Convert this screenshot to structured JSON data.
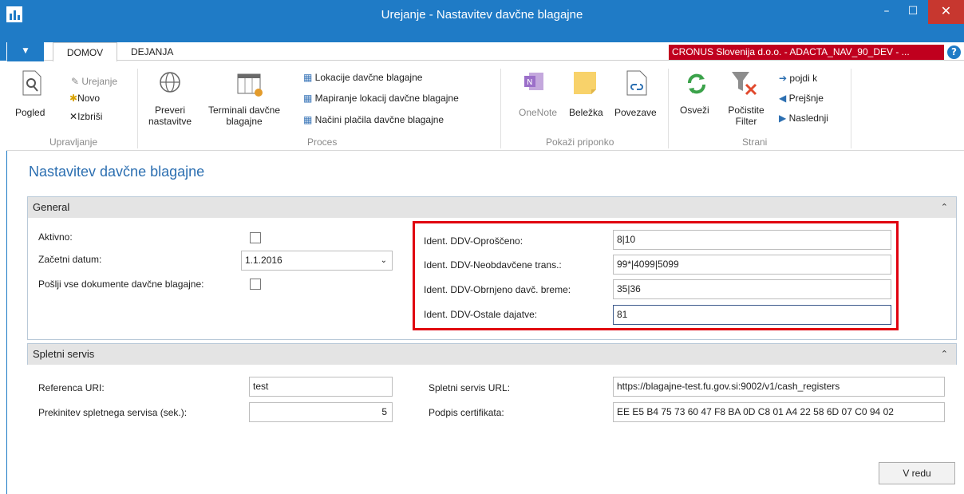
{
  "window": {
    "title": "Urejanje - Nastavitev davčne blagajne",
    "minimize": "–",
    "maximize": "☐",
    "close": "✕"
  },
  "ribbon": {
    "tabs": [
      "DOMOV",
      "DEJANJA"
    ],
    "company": "CRONUS Slovenija d.o.o. - ADACTA_NAV_90_DEV - ...",
    "help": "?",
    "manage": {
      "view": "Pogled",
      "edit": "Urejanje",
      "new": "Novo",
      "delete": "Izbriši",
      "group": "Upravljanje"
    },
    "process": {
      "check_line1": "Preveri",
      "check_line2": "nastavitve",
      "terminals_line1": "Terminali davčne",
      "terminals_line2": "blagajne",
      "locations": "Lokacije davčne blagajne",
      "mapping": "Mapiranje lokacij davčne blagajne",
      "payment": "Načini plačila davčne blagajne",
      "group": "Proces"
    },
    "attach": {
      "onenote": "OneNote",
      "note": "Beležka",
      "links": "Povezave",
      "group": "Pokaži priponko"
    },
    "page": {
      "refresh": "Osveži",
      "clear_line1": "Počistite",
      "clear_line2": "Filter",
      "goto": "pojdi k",
      "previous": "Prejšnje",
      "next": "Naslednji",
      "group": "Strani"
    }
  },
  "page_title": "Nastavitev davčne blagajne",
  "general": {
    "header": "General",
    "active_label": "Aktivno:",
    "start_date_label": "Začetni datum:",
    "start_date_value": "1.1.2016",
    "send_all_label": "Pošlji vse dokumente davčne blagajne:",
    "exempt_label": "Ident. DDV-Oproščeno:",
    "exempt_value": "8|10",
    "untaxed_label": "Ident. DDV-Neobdavčene trans.:",
    "untaxed_value": "99*|4099|5099",
    "reverse_label": "Ident. DDV-Obrnjeno davč. breme:",
    "reverse_value": "35|36",
    "other_label": "Ident. DDV-Ostale dajatve:",
    "other_value": "81"
  },
  "webservice": {
    "header": "Spletni servis",
    "uri_label": "Referenca URI:",
    "uri_value": "test",
    "timeout_label": "Prekinitev spletnega servisa (sek.):",
    "timeout_value": "5",
    "url_label": "Spletni servis URL:",
    "url_value": "https://blagajne-test.fu.gov.si:9002/v1/cash_registers",
    "cert_label": "Podpis certifikata:",
    "cert_value": "EE E5 B4 75 73 60 47 F8 BA 0D C8 01 A4 22 58 6D 07 C0 94 02"
  },
  "ok_button": "V redu",
  "colors": {
    "titlebar": "#1f7bc6",
    "company_badge": "#c0001e",
    "highlight": "#e0000f",
    "page_title": "#2c6fb1"
  }
}
